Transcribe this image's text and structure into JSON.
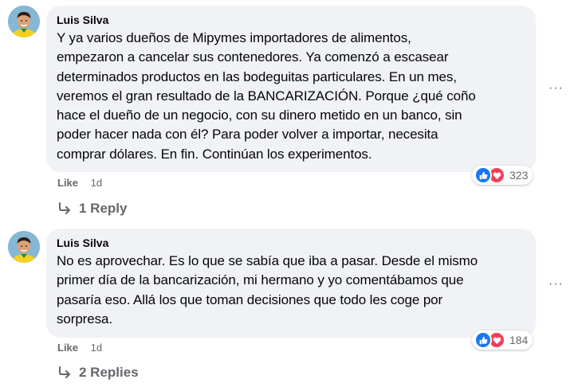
{
  "comments": [
    {
      "author": "Luis Silva",
      "text": "Y ya varios dueños de Mipymes importadores de alimentos,\nempezaron a cancelar sus contenedores. Ya comenzó a escasear\ndeterminados productos en las bodeguitas particulares. En un mes,\nveremos el gran resultado de la BANCARIZACIÓN. Porque ¿qué coño\nhace el dueño de un negocio, con su dinero metido en un banco, sin\npoder hacer nada con él? Para poder volver a importar, necesita\ncomprar dólares. En fin. Continúan los experimentos.",
      "reaction_count": "323",
      "like_label": "Like",
      "time": "1d",
      "replies_label": "1 Reply",
      "more_label": "···"
    },
    {
      "author": "Luis Silva",
      "text": "No es aprovechar. Es lo que se sabía que iba a pasar. Desde el mismo\nprimer día de la bancarización, mi hermano y yo comentábamos que\npasaría eso. Allá los que toman decisiones que todo les coge por\nsorpresa.",
      "reaction_count": "184",
      "like_label": "Like",
      "time": "1d",
      "replies_label": "2 Replies",
      "more_label": "···"
    }
  ],
  "colors": {
    "bubble": "#f0f2f5",
    "secondary_text": "#65676b",
    "like_blue": "#1877f2",
    "love_red": "#f33e58"
  },
  "icons": {
    "like": "thumbs-up-icon",
    "love": "heart-icon",
    "reply": "reply-arrow-icon",
    "more": "more-options-icon"
  }
}
